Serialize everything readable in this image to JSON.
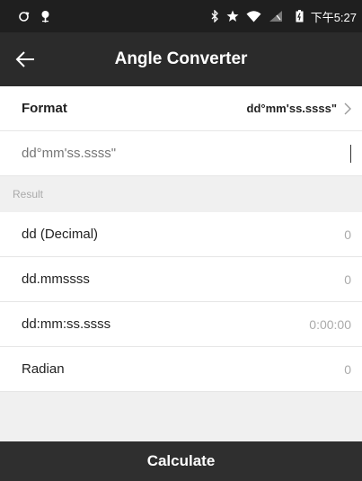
{
  "status_bar": {
    "time": "下午5:27",
    "icons": [
      "sync-icon",
      "location-pin-icon",
      "bluetooth-icon",
      "star-icon",
      "wifi-icon",
      "no-signal-icon",
      "battery-icon"
    ]
  },
  "app_bar": {
    "title": "Angle Converter",
    "back_icon": "back-arrow-icon"
  },
  "format": {
    "label": "Format",
    "value": "dd°mm'ss.ssss\""
  },
  "input": {
    "value": "",
    "placeholder": "dd°mm'ss.ssss\""
  },
  "result": {
    "header": "Result",
    "rows": [
      {
        "label": "dd (Decimal)",
        "value": "0"
      },
      {
        "label": "dd.mmssss",
        "value": "0"
      },
      {
        "label": "dd:mm:ss.ssss",
        "value": "0:00:00"
      },
      {
        "label": "Radian",
        "value": "0"
      }
    ]
  },
  "calculate_label": "Calculate",
  "colors": {
    "status_bar": "#1f1f1f",
    "app_bar": "#2b2b2b",
    "section_bg": "#f0f0f0",
    "muted_text": "#aaaaaa",
    "button_bg": "#2f2f2f"
  }
}
